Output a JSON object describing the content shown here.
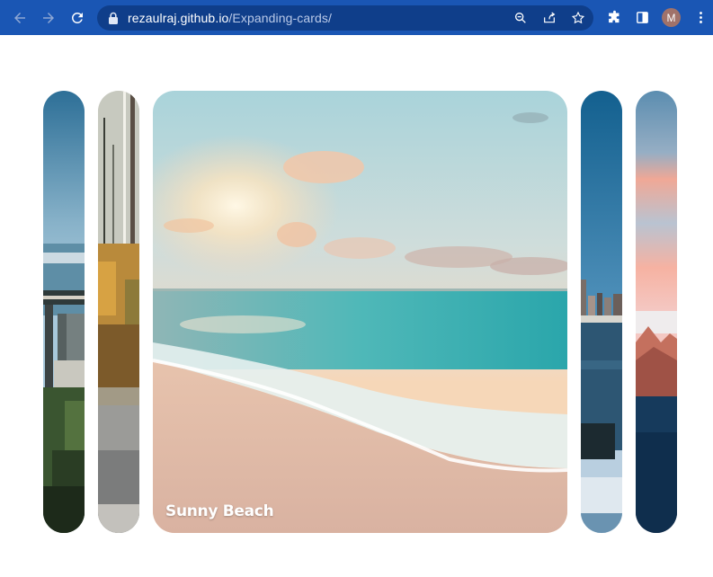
{
  "browser": {
    "url_host": "rezaulraj.github.io",
    "url_path": "/Expanding-cards/",
    "profile_initial": "M",
    "accent": "#1a56b4"
  },
  "cards": [
    {
      "id": "bridge",
      "title": "",
      "active": false
    },
    {
      "id": "forest",
      "title": "",
      "active": false
    },
    {
      "id": "beach",
      "title": "Sunny Beach",
      "active": true
    },
    {
      "id": "city",
      "title": "",
      "active": false
    },
    {
      "id": "mountain",
      "title": "",
      "active": false
    }
  ]
}
